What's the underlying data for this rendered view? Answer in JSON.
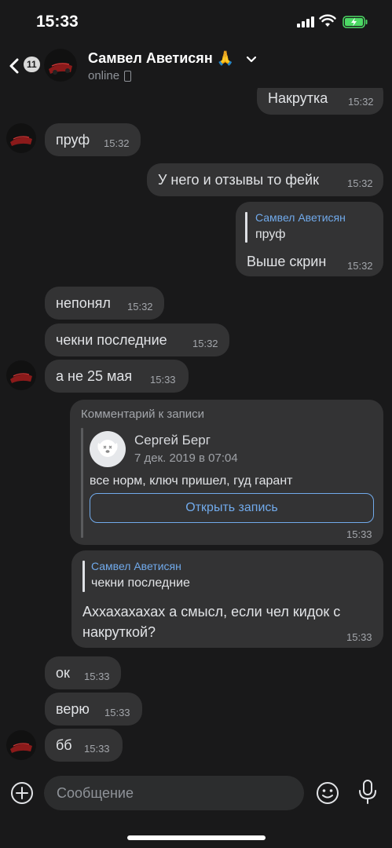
{
  "status_bar": {
    "time": "15:33"
  },
  "header": {
    "back_badge": "11",
    "name": "Самвел Аветисян 🙏",
    "status": "online"
  },
  "messages": [
    {
      "text": "Накрутка",
      "time": "15:32"
    },
    {
      "text": "пруф",
      "time": "15:32"
    },
    {
      "text": "У него и отзывы то фейк",
      "time": "15:32"
    },
    {
      "reply_name": "Самвел Аветисян",
      "reply_text": "пруф",
      "text": "Выше скрин",
      "time": "15:32"
    },
    {
      "text": "непонял",
      "time": "15:32"
    },
    {
      "text": "чекни последние",
      "time": "15:32"
    },
    {
      "text": "а не 25 мая",
      "time": "15:33"
    },
    {
      "label": "Комментарий к записи",
      "author": "Сергей Берг",
      "date": "7 дек. 2019 в 07:04",
      "text": "все норм, ключ пришел, гуд гарант",
      "button": "Открыть запись",
      "time": "15:33"
    },
    {
      "reply_name": "Самвел Аветисян",
      "reply_text": "чекни последние",
      "line1": "Аххахахахах а смысл, если чел кидок с",
      "line2": "накруткой?",
      "time": "15:33"
    },
    {
      "text": "ок",
      "time": "15:33"
    },
    {
      "text": "верю",
      "time": "15:33"
    },
    {
      "text": "бб",
      "time": "15:33"
    }
  ],
  "input": {
    "placeholder": "Сообщение"
  },
  "colors": {
    "background": "#19191a",
    "bubble": "#333334",
    "accent": "#71aaeb"
  }
}
